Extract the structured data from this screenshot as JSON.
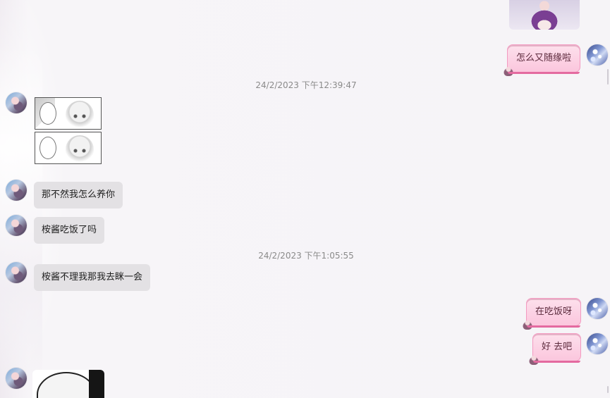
{
  "timestamps": {
    "t1": "24/2/2023 下午12:39:47",
    "t2": "24/2/2023 下午1:05:55"
  },
  "messages": {
    "m_right_1": "怎么又随缘啦",
    "m_left_1": "那不然我怎么养你",
    "m_left_2": "桉酱吃饭了吗",
    "m_left_3": "桉酱不理我那我去眯一会",
    "m_right_2": "在吃饭呀",
    "m_right_3": "好 去吧"
  },
  "colors": {
    "background": "#f6f4f7",
    "left_bubble": "#e3e1e4",
    "right_bubble": "#fbc6dd",
    "right_bubble_border": "#f39ac0",
    "timestamp": "#8a8a8a"
  },
  "icons": {
    "left_avatar": "contact-avatar-anime",
    "right_avatar": "self-avatar-anime",
    "bubble_decoration": "chibi-decoration"
  }
}
